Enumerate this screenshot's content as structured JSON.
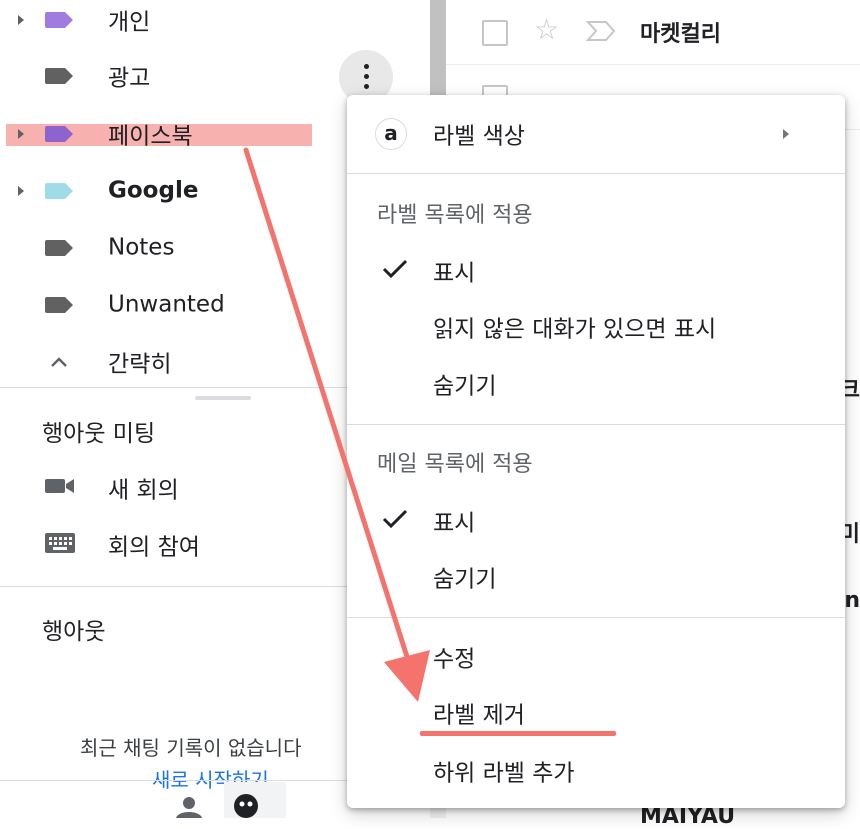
{
  "sidebar": {
    "labels": [
      {
        "name": "개인",
        "color": "#a07ce0",
        "has_children": true,
        "bold": false
      },
      {
        "name": "광고",
        "color": "#616161",
        "has_children": false,
        "bold": false
      },
      {
        "name": "페이스북",
        "color": "#8e63ce",
        "has_children": true,
        "bold": false
      },
      {
        "name": "Google",
        "color": "#9fdbe8",
        "has_children": true,
        "bold": true
      },
      {
        "name": "Notes",
        "color": "#616161",
        "has_children": false,
        "bold": false
      },
      {
        "name": "Unwanted",
        "color": "#616161",
        "has_children": false,
        "bold": false
      }
    ],
    "collapse_label": "간략히",
    "hangouts_meet": {
      "title": "행아웃 미팅",
      "new_meeting": "새 회의",
      "join_meeting": "회의 참여"
    },
    "hangouts": {
      "title": "행아웃",
      "empty_text": "최근 채팅 기록이 없습니다",
      "start_link": "새로 시작하기"
    }
  },
  "mail_list": {
    "rows": [
      {
        "sender": "마켓컬리"
      }
    ],
    "peeks": [
      "크",
      "미",
      "n",
      "MAIYAU"
    ]
  },
  "context_menu": {
    "color_item": {
      "icon_letter": "a",
      "label": "라벨 색상"
    },
    "label_list_header": "라벨 목록에 적용",
    "label_list_options": [
      {
        "label": "표시",
        "checked": true
      },
      {
        "label": "읽지 않은 대화가 있으면 표시",
        "checked": false
      },
      {
        "label": "숨기기",
        "checked": false
      }
    ],
    "mail_list_header": "메일 목록에 적용",
    "mail_list_options": [
      {
        "label": "표시",
        "checked": true
      },
      {
        "label": "숨기기",
        "checked": false
      }
    ],
    "actions": {
      "edit": "수정",
      "remove": "라벨 제거",
      "add_sublabel": "하위 라벨 추가"
    }
  },
  "annotation": {
    "color": "#f4736d",
    "highlight_color": "#f7b2b0"
  }
}
